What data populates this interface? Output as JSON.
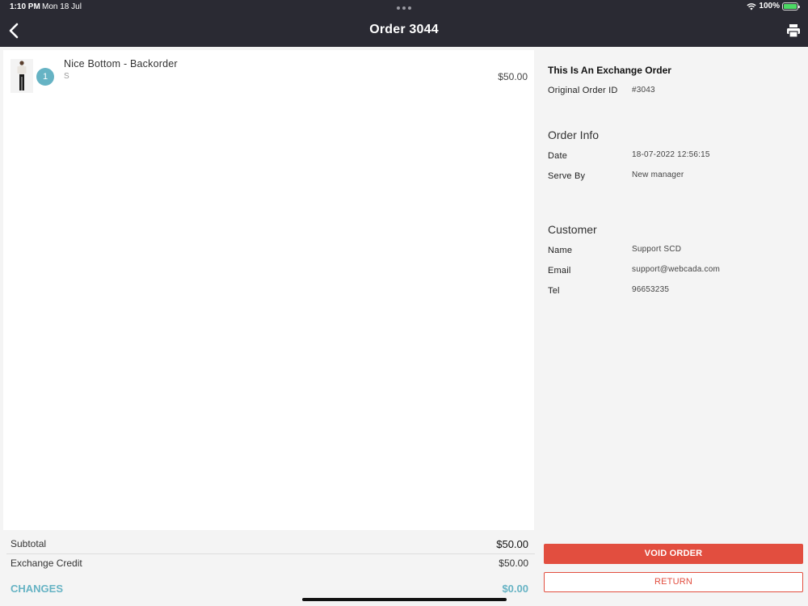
{
  "status": {
    "time": "1:10 PM",
    "date": "Mon 18 Jul",
    "battery": "100%"
  },
  "nav": {
    "title": "Order 3044"
  },
  "items": [
    {
      "name": "Nice Bottom - Backorder",
      "variant": "S",
      "qty": "1",
      "price": "$50.00"
    }
  ],
  "totals": {
    "subtotal_label": "Subtotal",
    "subtotal_value": "$50.00",
    "credit_label": "Exchange Credit",
    "credit_value": "$50.00",
    "changes_label": "CHANGES",
    "changes_value": "$0.00"
  },
  "info": {
    "exchange_title": "This Is An Exchange Order",
    "original_order_label": "Original Order ID",
    "original_order_value": "#3043",
    "order_info_title": "Order Info",
    "date_label": "Date",
    "date_value": "18-07-2022 12:56:15",
    "serve_label": "Serve By",
    "serve_value": "New manager",
    "customer_title": "Customer",
    "name_label": "Name",
    "name_value": "Support SCD",
    "email_label": "Email",
    "email_value": "support@webcada.com",
    "tel_label": "Tel",
    "tel_value": "96653235"
  },
  "actions": {
    "void_label": "VOID ORDER",
    "return_label": "RETURN"
  },
  "colors": {
    "accent": "#66b3c4",
    "danger": "#e24e3f",
    "nav_bg": "#2a2a33"
  },
  "icons": {
    "back": "chevron-left-icon",
    "print": "printer-icon",
    "wifi": "wifi-icon",
    "battery": "battery-charging-icon"
  }
}
